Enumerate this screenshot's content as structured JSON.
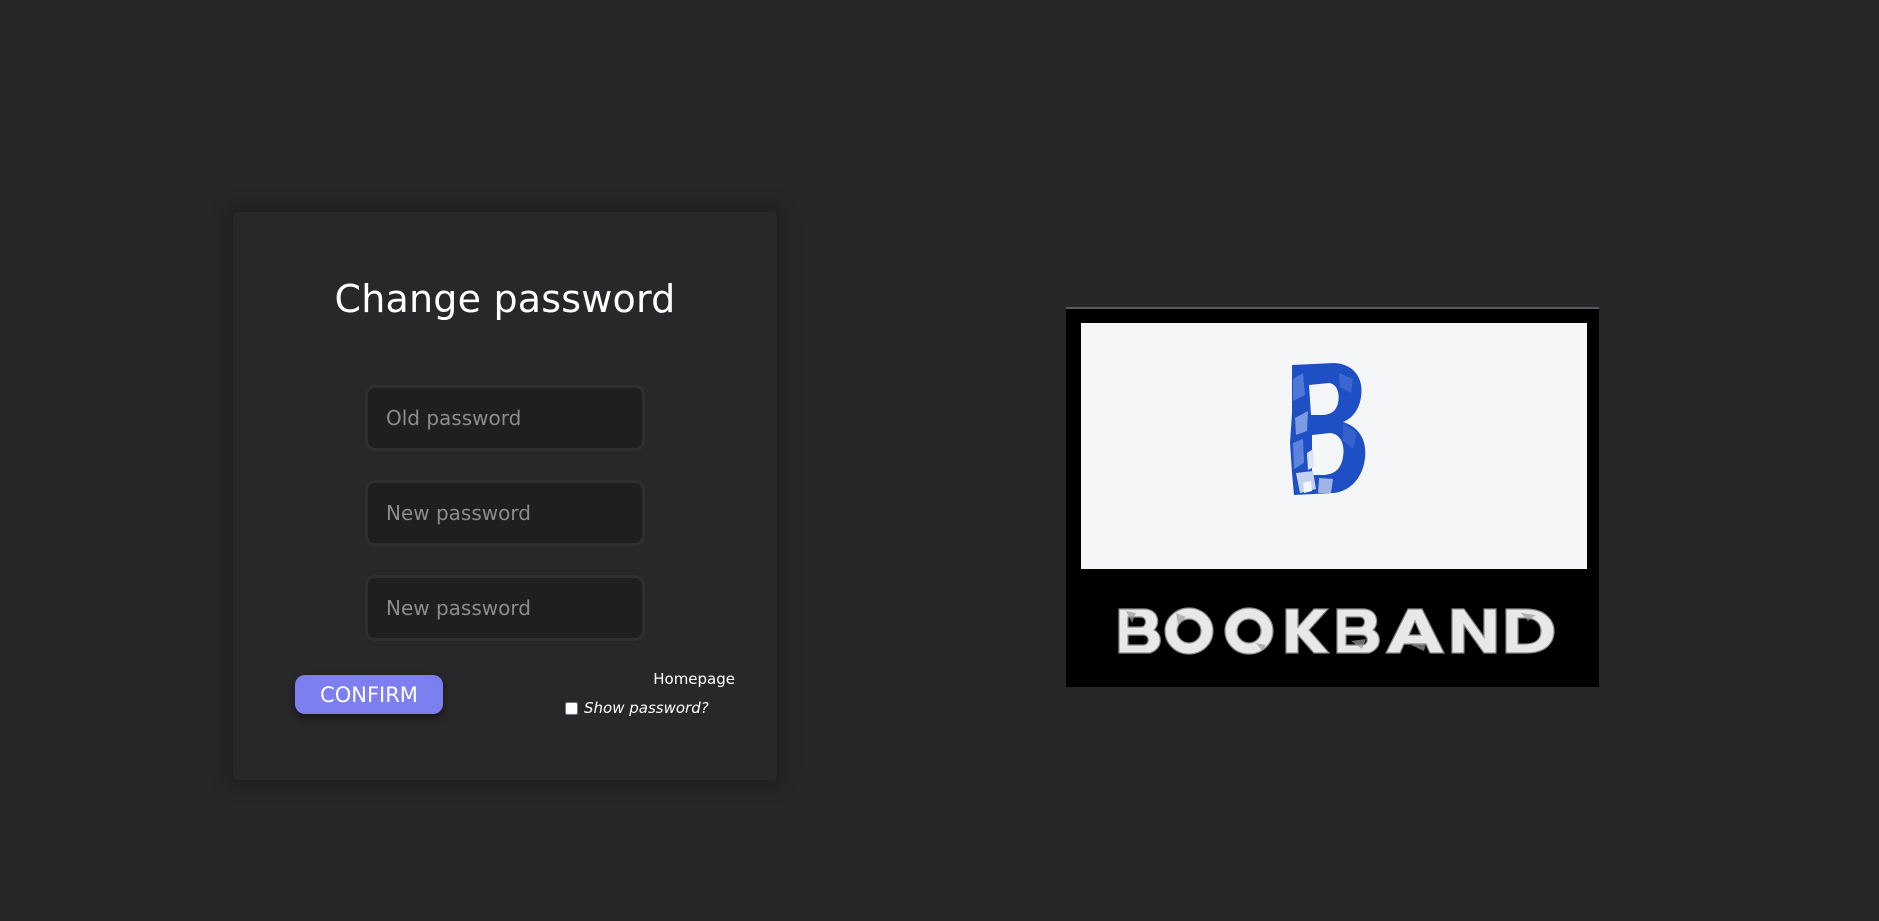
{
  "form": {
    "title": "Change password",
    "old_password_placeholder": "Old password",
    "new_password_placeholder": "New password",
    "confirm_password_placeholder": "New password",
    "confirm_label": "CONFIRM",
    "homepage_link": "Homepage",
    "show_password_label": "Show password?",
    "show_password_checked": false
  },
  "logo": {
    "letter": "B",
    "wordmark": "BOOKBAND"
  },
  "colors": {
    "background": "#27272a",
    "card": "#28282b",
    "accent": "#7d7ff0",
    "logo_blue": "#1f4fc4",
    "logo_panel": "#f5f6f8"
  },
  "icons": {
    "checkbox": "checkbox-unchecked"
  }
}
